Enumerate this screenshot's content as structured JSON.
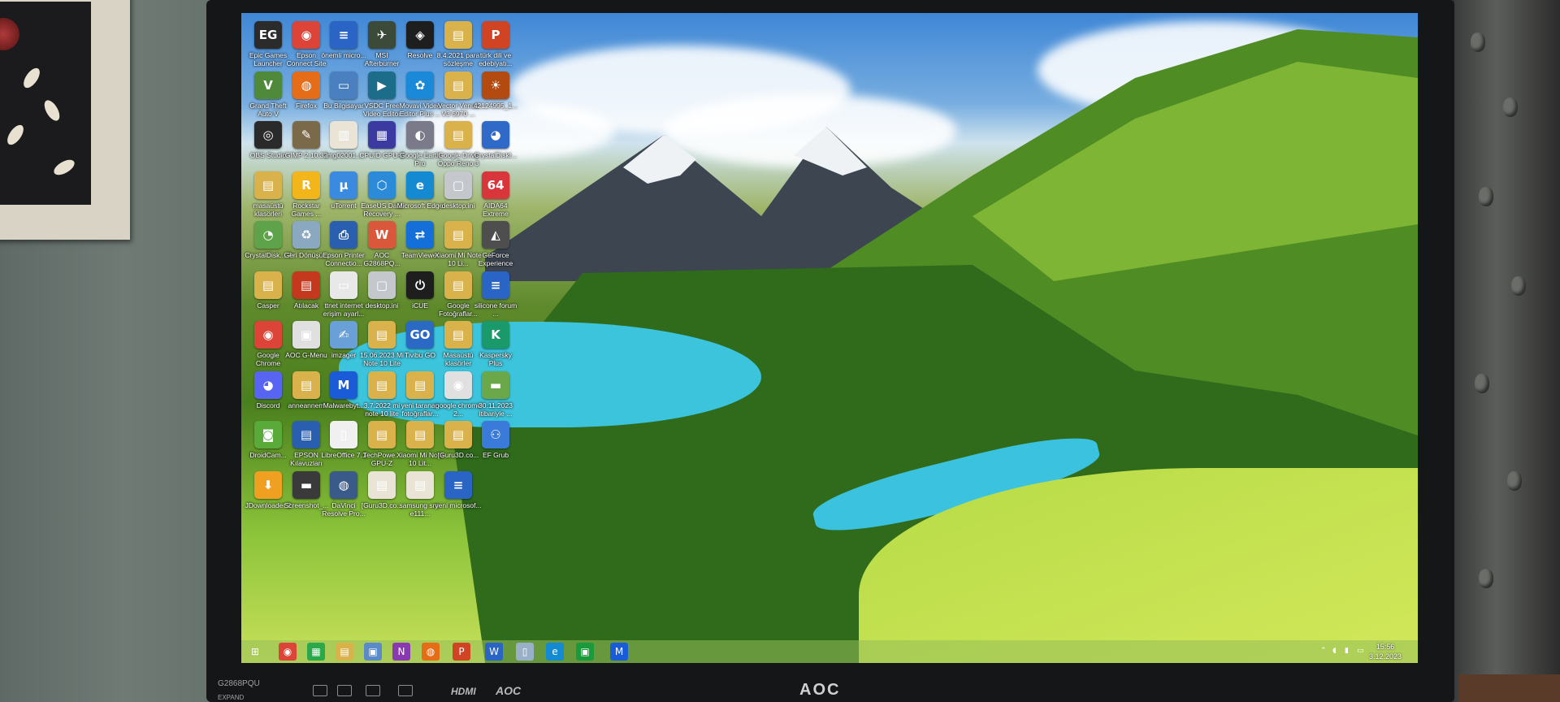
{
  "monitor": {
    "brand": "AOC",
    "model": "G2868PQU",
    "model_sub": "EXPAND",
    "port_label": "HDMI",
    "port_brand": "AOC"
  },
  "desktop": {
    "icons": [
      {
        "label": "Epic Games Launcher",
        "color": "#2b2b2b",
        "glyph": "EG"
      },
      {
        "label": "Epson Connect Site",
        "color": "#db4437",
        "glyph": "◉"
      },
      {
        "label": "önemli micro...",
        "color": "#2a64c4",
        "glyph": "≡"
      },
      {
        "label": "MSI Afterburner",
        "color": "#3c4a3a",
        "glyph": "✈"
      },
      {
        "label": "Resolve",
        "color": "#1e1e1e",
        "glyph": "◈"
      },
      {
        "label": "8.4.2021 para sözleşme",
        "color": "#d9b24c",
        "glyph": "▤"
      },
      {
        "label": "türk dili ve edebiyatı...",
        "color": "#d04423",
        "glyph": "P"
      },
      {
        "label": "Grand Theft Auto V",
        "color": "#4f8a3a",
        "glyph": "V"
      },
      {
        "label": "Firefox",
        "color": "#e66d17",
        "glyph": "◍"
      },
      {
        "label": "Bu Bilgisayar",
        "color": "#4a7fc0",
        "glyph": "▭"
      },
      {
        "label": "VSDC Free Video Editor",
        "color": "#1c6d8a",
        "glyph": "▶"
      },
      {
        "label": "Movavi Video Editor Plus ...",
        "color": "#1a8ad8",
        "glyph": "✿"
      },
      {
        "label": "Vector Venus V3 5970 ...",
        "color": "#d9b24c",
        "glyph": "▤"
      },
      {
        "label": "42124995_1...",
        "color": "#b34a10",
        "glyph": "☀"
      },
      {
        "label": "OBS Studio",
        "color": "#2a2a2a",
        "glyph": "◎"
      },
      {
        "label": "GIMP 2.10.32",
        "color": "#7a6a4a",
        "glyph": "✎"
      },
      {
        "label": "img02001...",
        "color": "#e9e4d6",
        "glyph": "▥"
      },
      {
        "label": "CPUID GPU-Z",
        "color": "#3a3aa0",
        "glyph": "▦"
      },
      {
        "label": "Google Earth Pro",
        "color": "#7a7a8a",
        "glyph": "◐"
      },
      {
        "label": "Google Drive Oppo Reno 3",
        "color": "#d9b24c",
        "glyph": "▤"
      },
      {
        "label": "CrystalDiskI...",
        "color": "#2f6ac8",
        "glyph": "◕"
      },
      {
        "label": "masaüstü klasörleri",
        "color": "#d9b24c",
        "glyph": "▤"
      },
      {
        "label": "Rockstar Games ...",
        "color": "#f2b51a",
        "glyph": "R"
      },
      {
        "label": "uTorrent",
        "color": "#3a8ae0",
        "glyph": "μ"
      },
      {
        "label": "EaseUS Data Recovery ...",
        "color": "#2b8bd8",
        "glyph": "⬡"
      },
      {
        "label": "Microsoft Edge",
        "color": "#138ad1",
        "glyph": "e"
      },
      {
        "label": "desktop.ini",
        "color": "#c4c8cc",
        "glyph": "▢"
      },
      {
        "label": "AIDA64 Extreme",
        "color": "#d8363a",
        "glyph": "64"
      },
      {
        "label": "CrystalDisk... 7",
        "color": "#5ea34a",
        "glyph": "◔"
      },
      {
        "label": "Geri Dönüşü...",
        "color": "#8aa8c0",
        "glyph": "♻"
      },
      {
        "label": "Epson Printer Connectio...",
        "color": "#2a5fb0",
        "glyph": "⎙"
      },
      {
        "label": "AOC G2868PQ...",
        "color": "#d9573a",
        "glyph": "W"
      },
      {
        "label": "TeamViewer",
        "color": "#1470d8",
        "glyph": "⇄"
      },
      {
        "label": "Xiaomi Mi Note 10 Li...",
        "color": "#d9b24c",
        "glyph": "▤"
      },
      {
        "label": "GeForce Experience",
        "color": "#4e4e4e",
        "glyph": "◭"
      },
      {
        "label": "Casper",
        "color": "#d9b24c",
        "glyph": "▤"
      },
      {
        "label": "Atılacak",
        "color": "#c4381e",
        "glyph": "▤"
      },
      {
        "label": "ttnet internet erişim ayarl...",
        "color": "#e8e8e8",
        "glyph": "▭"
      },
      {
        "label": "desktop.ini",
        "color": "#c4c8cc",
        "glyph": "▢"
      },
      {
        "label": "iCUE",
        "color": "#1e1e1e",
        "glyph": "⏻"
      },
      {
        "label": "Google Fotoğraflar...",
        "color": "#d9b24c",
        "glyph": "▤"
      },
      {
        "label": "silicone forum ...",
        "color": "#2a64c4",
        "glyph": "≡"
      },
      {
        "label": "Google Chrome",
        "color": "#db4437",
        "glyph": "◉"
      },
      {
        "label": "AOC G-Menu",
        "color": "#e0e0e0",
        "glyph": "▣"
      },
      {
        "label": "imzager",
        "color": "#6aa0d8",
        "glyph": "✍"
      },
      {
        "label": "15.06.2023 Mi Note 10 Lite",
        "color": "#d9b24c",
        "glyph": "▤"
      },
      {
        "label": "Tivibu GO",
        "color": "#2a6ac4",
        "glyph": "GO"
      },
      {
        "label": "Masaüstü klasörler",
        "color": "#d9b24c",
        "glyph": "▤"
      },
      {
        "label": "Kaspersky Plus",
        "color": "#1a9a6a",
        "glyph": "K"
      },
      {
        "label": "Discord",
        "color": "#5865f2",
        "glyph": "◕"
      },
      {
        "label": "anneannem",
        "color": "#d9b24c",
        "glyph": "▤"
      },
      {
        "label": "Malwarebyt...",
        "color": "#1a5cd8",
        "glyph": "M"
      },
      {
        "label": "3.7.2022 mi note 10 lite",
        "color": "#d9b24c",
        "glyph": "▤"
      },
      {
        "label": "yeni taranan fotoğraflar...",
        "color": "#d9b24c",
        "glyph": "▤"
      },
      {
        "label": "google chrome 2...",
        "color": "#e0e0e0",
        "glyph": "◉"
      },
      {
        "label": "30.11.2023 itibariyle ...",
        "color": "#6aa84a",
        "glyph": "▬"
      },
      {
        "label": "DroidCam...",
        "color": "#5aaa3a",
        "glyph": "◙"
      },
      {
        "label": "EPSON Kılavuzları",
        "color": "#2a5fb0",
        "glyph": "▤"
      },
      {
        "label": "LibreOffice 7.1",
        "color": "#f0f0f0",
        "glyph": "▯"
      },
      {
        "label": "TechPowe... GPU-Z",
        "color": "#d9b24c",
        "glyph": "▤"
      },
      {
        "label": "Xiaomi Mi Note 10 Lit...",
        "color": "#d9b24c",
        "glyph": "▤"
      },
      {
        "label": "[Guru3D.co...",
        "color": "#d9b24c",
        "glyph": "▤"
      },
      {
        "label": "EF Grub",
        "color": "#3a7ad8",
        "glyph": "⚇"
      },
      {
        "label": "JDownloader 2",
        "color": "#f0a020",
        "glyph": "⬇"
      },
      {
        "label": "Screenshot_...",
        "color": "#3a3a3a",
        "glyph": "▬"
      },
      {
        "label": "DaVinci Resolve Pro...",
        "color": "#3a5a8a",
        "glyph": "◍"
      },
      {
        "label": "[Guru3D.co...",
        "color": "#e9e4d6",
        "glyph": "▤"
      },
      {
        "label": "samsung sm-e111...",
        "color": "#e9e4d6",
        "glyph": "▤"
      },
      {
        "label": "yeni microsof...",
        "color": "#2a64c4",
        "glyph": "≡"
      }
    ]
  },
  "taskbar": {
    "items": [
      {
        "name": "start-button",
        "icon": "windows-icon",
        "glyph": "⊞",
        "color": "transparent"
      },
      {
        "name": "taskbar-chrome",
        "icon": "chrome-icon",
        "glyph": "◉",
        "color": "#db4437"
      },
      {
        "name": "taskbar-store",
        "icon": "store-icon",
        "glyph": "▦",
        "color": "#2aa84a"
      },
      {
        "name": "taskbar-explorer",
        "icon": "folder-icon",
        "glyph": "▤",
        "color": "#d9b24c"
      },
      {
        "name": "taskbar-network",
        "icon": "network-icon",
        "glyph": "▣",
        "color": "#5a8ac8"
      },
      {
        "name": "taskbar-onenote",
        "icon": "onenote-icon",
        "glyph": "N",
        "color": "#8a3ab0"
      },
      {
        "name": "taskbar-firefox",
        "icon": "firefox-icon",
        "glyph": "◍",
        "color": "#e66d17"
      },
      {
        "name": "taskbar-powerpoint",
        "icon": "powerpoint-icon",
        "glyph": "P",
        "color": "#d04423"
      },
      {
        "name": "taskbar-word",
        "icon": "word-icon",
        "glyph": "W",
        "color": "#2a64c4"
      },
      {
        "name": "taskbar-notepad",
        "icon": "document-icon",
        "glyph": "▯",
        "color": "#9ab0c8"
      },
      {
        "name": "taskbar-edge",
        "icon": "edge-icon",
        "glyph": "e",
        "color": "#138ad1"
      },
      {
        "name": "taskbar-xbox",
        "icon": "xbox-icon",
        "glyph": "▣",
        "color": "#1a9a3a"
      },
      {
        "name": "taskbar-malwarebytes",
        "icon": "malwarebytes-icon",
        "glyph": "M",
        "color": "#1a5cd8"
      }
    ],
    "clock_time": "15:56",
    "clock_date": "3.12.2023"
  }
}
